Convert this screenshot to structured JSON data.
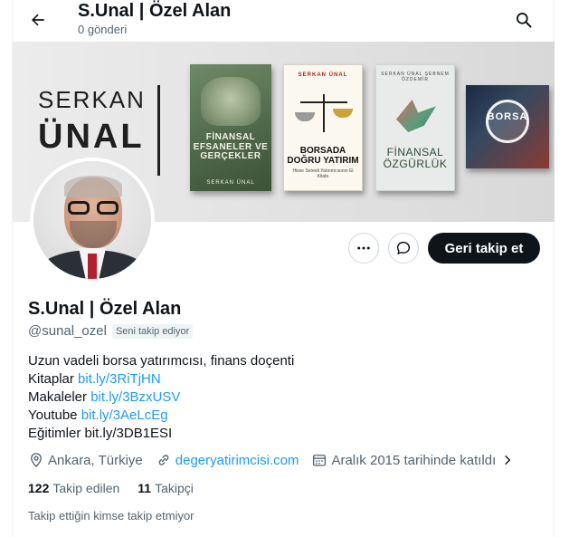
{
  "header": {
    "title": "S.Unal | Özel Alan",
    "post_count": "0 gönderi",
    "back_icon": "arrow-left-icon",
    "search_icon": "search-icon"
  },
  "banner": {
    "brand_line1": "SERKAN",
    "brand_line2": "ÜNAL",
    "books": [
      {
        "title": "FİNANSAL EFSANELER VE GERÇEKLER",
        "author": "SERKAN ÜNAL"
      },
      {
        "title": "BORSADA DOĞRU YATIRIM",
        "author": "SERKAN ÜNAL",
        "subtitle": "Hisse Senedi Yatırımcısının El Kitabı"
      },
      {
        "title": "FİNANSAL ÖZGÜRLÜK",
        "author": "SERKAN ÜNAL  ŞEBNEM ÖZDEMİR"
      },
      {
        "title": "BORSA",
        "author": ""
      }
    ]
  },
  "actions": {
    "more_icon": "more-horizontal-icon",
    "message_icon": "message-icon",
    "follow_label": "Geri takip et"
  },
  "profile": {
    "name": "S.Unal | Özel Alan",
    "handle": "@sunal_ozel",
    "follows_you": "Seni takip ediyor",
    "bio": [
      {
        "text": "Uzun vadeli borsa yatırımcısı, finans doçenti",
        "link": ""
      },
      {
        "text": "Kitaplar ",
        "link": "bit.ly/3RiTjHN"
      },
      {
        "text": "Makaleler ",
        "link": "bit.ly/3BzxUSV"
      },
      {
        "text": "Youtube ",
        "link": "bit.ly/3AeLcEg"
      },
      {
        "text": "Eğitimler bit.ly/3DB1ESI",
        "link": ""
      }
    ],
    "location": "Ankara, Türkiye",
    "website": "degeryatirimcisi.com",
    "joined": "Aralık 2015 tarihinde katıldı",
    "following_count": "122",
    "following_label": "Takip edilen",
    "followers_count": "11",
    "followers_label": "Takipçi",
    "mutual_text": "Takip ettiğin kimse takip etmiyor"
  },
  "colors": {
    "accent": "#1d9bf0",
    "text": "#0f1419",
    "muted": "#536471",
    "follow_button": "#0f1419"
  }
}
